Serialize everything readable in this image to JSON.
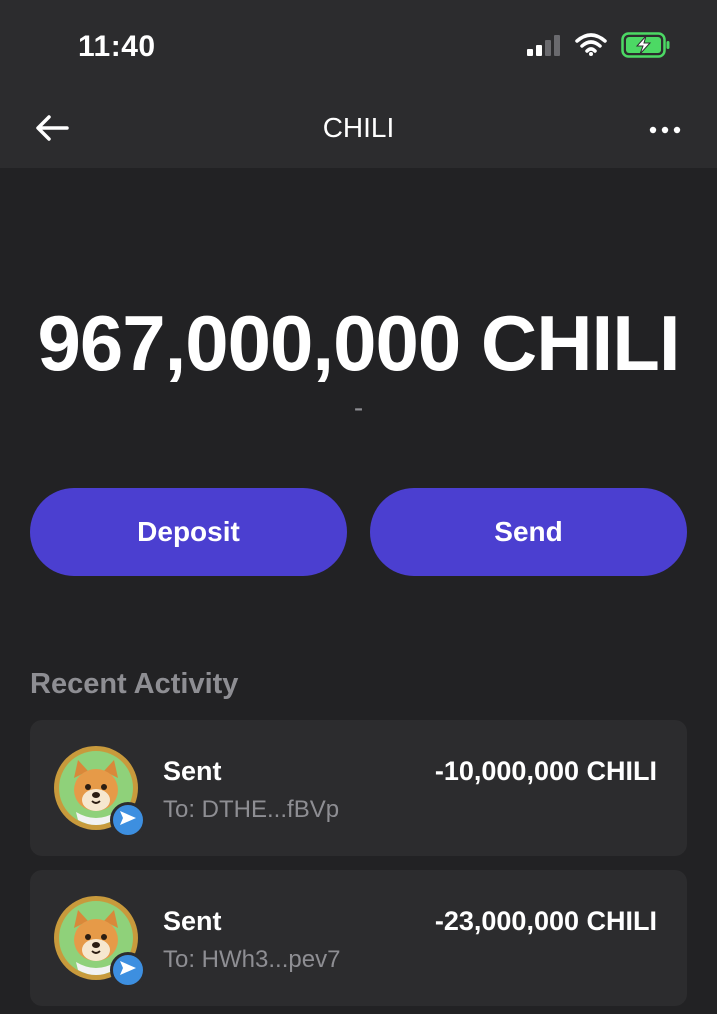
{
  "status_bar": {
    "time": "11:40",
    "signal_icon": "cellular-signal-icon",
    "wifi_icon": "wifi-icon",
    "battery_icon": "battery-charging-icon"
  },
  "nav": {
    "title": "CHILI",
    "back_icon": "arrow-left-icon",
    "more_icon": "more-horizontal-icon"
  },
  "balance": {
    "amount": "967,000,000 CHILI",
    "fiat": "-"
  },
  "actions": {
    "deposit_label": "Deposit",
    "send_label": "Send"
  },
  "activity": {
    "title": "Recent Activity",
    "items": [
      {
        "type": "Sent",
        "to": "To: DTHE...fBVp",
        "amount": "-10,000,000 CHILI"
      },
      {
        "type": "Sent",
        "to": "To: HWh3...pev7",
        "amount": "-23,000,000 CHILI"
      }
    ]
  },
  "colors": {
    "background": "#222224",
    "surface": "#2c2c2e",
    "accent": "#4b3fd0",
    "muted_text": "#8e8e93",
    "badge": "#3d8fe0",
    "battery_green": "#4cd964"
  }
}
